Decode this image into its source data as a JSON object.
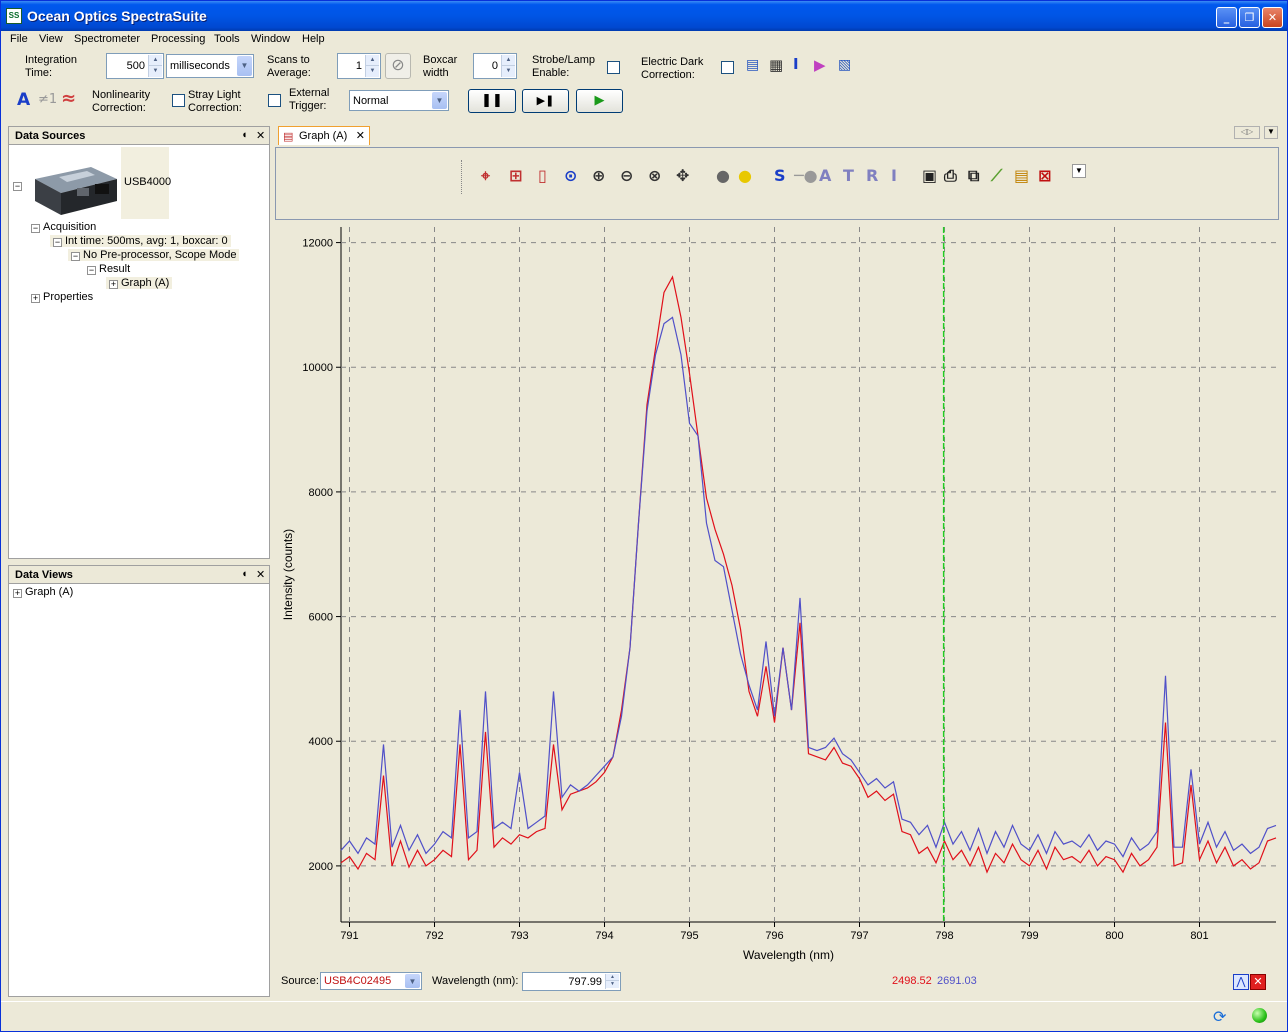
{
  "window": {
    "title": "Ocean Optics SpectraSuite",
    "app_icon_text": "SS"
  },
  "menu": [
    "File",
    "View",
    "Spectrometer",
    "Processing",
    "Tools",
    "Window",
    "Help"
  ],
  "acquisition_bar": {
    "integration_time_label_1": "Integration",
    "integration_time_label_2": "Time:",
    "integration_time_value": "500",
    "integration_units": "milliseconds",
    "scans_label_1": "Scans to",
    "scans_label_2": "Average:",
    "scans_value": "1",
    "boxcar_label_1": "Boxcar",
    "boxcar_label_2": "width",
    "boxcar_value": "0",
    "strobe_label_1": "Strobe/Lamp",
    "strobe_label_2": "Enable:",
    "electric_dark_label_1": "Electric Dark",
    "electric_dark_label_2": "Correction:",
    "nonlinearity_label_1": "Nonlinearity",
    "nonlinearity_label_2": "Correction:",
    "stray_light_label_1": "Stray Light",
    "stray_light_label_2": "Correction:",
    "external_trigger_label_1": "External",
    "external_trigger_label_2": "Trigger:",
    "trigger_mode": "Normal",
    "icon_text_a": "A",
    "icon_text_ne1": "≠1",
    "icon_text_wave": "≈"
  },
  "data_sources": {
    "title": "Data Sources",
    "device": "USB4000",
    "tree": [
      {
        "label": "Acquisition"
      },
      {
        "label": "Int time: 500ms, avg: 1, boxcar: 0"
      },
      {
        "label": "No Pre-processor, Scope Mode"
      },
      {
        "label": "Result"
      },
      {
        "label": "Graph (A)"
      },
      {
        "label": "Properties"
      }
    ]
  },
  "data_views": {
    "title": "Data Views",
    "items": [
      "Graph (A)"
    ]
  },
  "graph_tab": {
    "label": "Graph (A)"
  },
  "graph_toolbar": {
    "letters": [
      "S",
      "A",
      "T",
      "R",
      "I"
    ]
  },
  "status": {
    "source_label": "Source:",
    "source_value": "USB4C02495",
    "wavelength_label": "Wavelength (nm):",
    "wavelength_value": "797.99",
    "red_readout": "2498.52",
    "blue_readout": "2691.03"
  },
  "colors": {
    "series_red": "#e0101a",
    "series_blue": "#5050c8",
    "cursor": "#22cc22",
    "accent": "#0054e3"
  },
  "chart_data": {
    "type": "line",
    "xlabel": "Wavelength (nm)",
    "ylabel": "Intensity (counts)",
    "xlim": [
      790.9,
      801.9
    ],
    "ylim": [
      1100,
      12250
    ],
    "x_ticks": [
      791,
      792,
      793,
      794,
      795,
      796,
      797,
      798,
      799,
      800,
      801
    ],
    "y_ticks": [
      2000,
      4000,
      6000,
      8000,
      10000,
      12000
    ],
    "grid": true,
    "cursor_x": 797.99,
    "series": [
      {
        "color": "#e0101a",
        "x": [
          790.9,
          791.0,
          791.1,
          791.2,
          791.3,
          791.4,
          791.5,
          791.6,
          791.7,
          791.8,
          791.9,
          792.0,
          792.1,
          792.2,
          792.3,
          792.4,
          792.5,
          792.6,
          792.7,
          792.8,
          792.9,
          793.0,
          793.1,
          793.2,
          793.3,
          793.4,
          793.5,
          793.6,
          793.7,
          793.8,
          793.9,
          794.0,
          794.1,
          794.2,
          794.3,
          794.4,
          794.5,
          794.6,
          794.7,
          794.8,
          794.9,
          795.0,
          795.1,
          795.2,
          795.3,
          795.4,
          795.5,
          795.6,
          795.7,
          795.8,
          795.9,
          796.0,
          796.1,
          796.2,
          796.3,
          796.4,
          796.5,
          796.6,
          796.7,
          796.8,
          796.9,
          797.0,
          797.1,
          797.2,
          797.3,
          797.4,
          797.5,
          797.6,
          797.7,
          797.8,
          797.9,
          798.0,
          798.1,
          798.2,
          798.3,
          798.4,
          798.5,
          798.6,
          798.7,
          798.8,
          798.9,
          799.0,
          799.1,
          799.2,
          799.3,
          799.4,
          799.5,
          799.6,
          799.7,
          799.8,
          799.9,
          800.0,
          800.1,
          800.2,
          800.3,
          800.4,
          800.5,
          800.6,
          800.7,
          800.8,
          800.9,
          801.0,
          801.1,
          801.2,
          801.3,
          801.4,
          801.5,
          801.6,
          801.7,
          801.8,
          801.9
        ],
        "values": [
          2050,
          2150,
          1950,
          2200,
          2100,
          3450,
          2000,
          2400,
          1980,
          2250,
          2000,
          2100,
          2250,
          2150,
          3950,
          2100,
          2250,
          4150,
          2300,
          2450,
          2350,
          2500,
          2450,
          2550,
          2600,
          3950,
          2900,
          3150,
          3200,
          3250,
          3350,
          3500,
          3750,
          4500,
          5500,
          7500,
          9400,
          10300,
          11200,
          11450,
          10800,
          9900,
          8900,
          7900,
          7400,
          7000,
          6500,
          5800,
          4800,
          4400,
          5200,
          4300,
          5500,
          4500,
          5900,
          3800,
          3750,
          3700,
          3900,
          3650,
          3600,
          3400,
          3100,
          3200,
          3050,
          3150,
          2550,
          2500,
          2200,
          2300,
          2050,
          2400,
          2100,
          2250,
          2000,
          2300,
          1900,
          2200,
          2050,
          2350,
          2100,
          2000,
          2250,
          1950,
          2300,
          2100,
          2150,
          2050,
          2250,
          2000,
          2150,
          2100,
          1900,
          2200,
          2000,
          2100,
          2300,
          4300,
          2000,
          2050,
          3300,
          2100,
          2400,
          2050,
          2300,
          2000,
          2100,
          1950,
          2050,
          2400,
          2450
        ],
        "name": ""
      },
      {
        "color": "#5050c8",
        "x": [
          790.9,
          791.0,
          791.1,
          791.2,
          791.3,
          791.4,
          791.5,
          791.6,
          791.7,
          791.8,
          791.9,
          792.0,
          792.1,
          792.2,
          792.3,
          792.4,
          792.5,
          792.6,
          792.7,
          792.8,
          792.9,
          793.0,
          793.1,
          793.2,
          793.3,
          793.4,
          793.5,
          793.6,
          793.7,
          793.8,
          793.9,
          794.0,
          794.1,
          794.2,
          794.3,
          794.4,
          794.5,
          794.6,
          794.7,
          794.8,
          794.9,
          795.0,
          795.1,
          795.2,
          795.3,
          795.4,
          795.5,
          795.6,
          795.7,
          795.8,
          795.9,
          796.0,
          796.1,
          796.2,
          796.3,
          796.4,
          796.5,
          796.6,
          796.7,
          796.8,
          796.9,
          797.0,
          797.1,
          797.2,
          797.3,
          797.4,
          797.5,
          797.6,
          797.7,
          797.8,
          797.9,
          798.0,
          798.1,
          798.2,
          798.3,
          798.4,
          798.5,
          798.6,
          798.7,
          798.8,
          798.9,
          799.0,
          799.1,
          799.2,
          799.3,
          799.4,
          799.5,
          799.6,
          799.7,
          799.8,
          799.9,
          800.0,
          800.1,
          800.2,
          800.3,
          800.4,
          800.5,
          800.6,
          800.7,
          800.8,
          800.9,
          801.0,
          801.1,
          801.2,
          801.3,
          801.4,
          801.5,
          801.6,
          801.7,
          801.8,
          801.9
        ],
        "values": [
          2250,
          2400,
          2200,
          2450,
          2350,
          3950,
          2300,
          2650,
          2250,
          2500,
          2200,
          2350,
          2550,
          2450,
          4500,
          2450,
          2550,
          4800,
          2600,
          2700,
          2600,
          3500,
          2600,
          2700,
          2800,
          4800,
          3100,
          3300,
          3200,
          3300,
          3450,
          3600,
          3750,
          4400,
          5500,
          7500,
          9300,
          10200,
          10700,
          10800,
          10200,
          9100,
          8900,
          7500,
          6900,
          6800,
          6100,
          5400,
          4900,
          4500,
          5600,
          4400,
          5500,
          4500,
          6300,
          3900,
          3850,
          3900,
          4050,
          3800,
          3700,
          3500,
          3300,
          3400,
          3250,
          3350,
          2750,
          2700,
          2500,
          2650,
          2300,
          2700,
          2350,
          2550,
          2250,
          2600,
          2200,
          2550,
          2300,
          2650,
          2350,
          2250,
          2500,
          2200,
          2550,
          2350,
          2400,
          2300,
          2500,
          2250,
          2400,
          2350,
          2150,
          2450,
          2250,
          2350,
          2550,
          5050,
          2300,
          2300,
          3550,
          2350,
          2700,
          2300,
          2550,
          2250,
          2350,
          2200,
          2300,
          2600,
          2650
        ],
        "name": ""
      }
    ]
  }
}
